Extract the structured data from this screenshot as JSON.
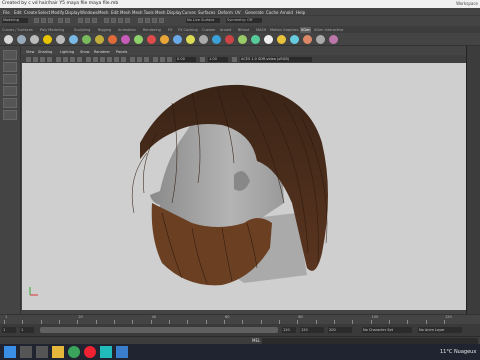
{
  "window": {
    "title": "Created by c vd hair/hair Y5 maya file maya file.mb",
    "workspace": "Workspace"
  },
  "menubar": [
    "File",
    "Edit",
    "Create",
    "Select",
    "Modify",
    "Display",
    "Windows",
    "Mesh",
    "Edit Mesh",
    "Mesh Tools",
    "Mesh Display",
    "Curves",
    "Surfaces",
    "Deform",
    "UV",
    "Generate",
    "Cache",
    "Arnold",
    "Help"
  ],
  "statusline": {
    "mode": "Modeling",
    "live_surface": "No Live Surface",
    "symmetry": "Symmetry: Off",
    "icons": [
      "new-scene",
      "open-scene",
      "save-scene",
      "undo",
      "redo",
      "select-hierarchy",
      "select-object",
      "select-component",
      "snap-grid",
      "snap-curve",
      "snap-point",
      "snap-surface",
      "render-frame",
      "ipr-render",
      "render-settings",
      "hypershade"
    ]
  },
  "shelf_tabs": [
    {
      "label": "Curves / Surfaces",
      "active": false
    },
    {
      "label": "Poly Modeling",
      "active": false
    },
    {
      "label": "Sculpting",
      "active": false
    },
    {
      "label": "Rigging",
      "active": false
    },
    {
      "label": "Animation",
      "active": false
    },
    {
      "label": "Rendering",
      "active": false
    },
    {
      "label": "FX",
      "active": false
    },
    {
      "label": "FX Caching",
      "active": false
    },
    {
      "label": "Custom",
      "active": false
    },
    {
      "label": "Arnold",
      "active": false
    },
    {
      "label": "Bifrost",
      "active": false
    },
    {
      "label": "MASH",
      "active": false
    },
    {
      "label": "Motion Graphics",
      "active": false
    },
    {
      "label": "XGen",
      "active": true
    },
    {
      "label": "XGen Interactive",
      "active": false
    }
  ],
  "shelf_icons": [
    {
      "name": "sphere",
      "color": "#d7d7d7"
    },
    {
      "name": "cube",
      "color": "#9ab"
    },
    {
      "name": "cylinder",
      "color": "#bbb"
    },
    {
      "name": "cone",
      "color": "#e8c400"
    },
    {
      "name": "plane",
      "color": "#bbb"
    },
    {
      "name": "torus",
      "color": "#7ab8e6"
    },
    {
      "name": "xgen-description",
      "color": "#7aba5c"
    },
    {
      "name": "xgen-editor",
      "color": "#c0ad3a"
    },
    {
      "name": "groom",
      "color": "#e06b3a"
    },
    {
      "name": "guide",
      "color": "#c65bb8"
    },
    {
      "name": "comb",
      "color": "#8fd16a"
    },
    {
      "name": "cut",
      "color": "#dd4b4b"
    },
    {
      "name": "noise",
      "color": "#e8a638"
    },
    {
      "name": "clump",
      "color": "#6aa9e8"
    },
    {
      "name": "coil",
      "color": "#dddd55"
    },
    {
      "name": "smooth",
      "color": "#aaa"
    },
    {
      "name": "density",
      "color": "#3aa2d8"
    },
    {
      "name": "length",
      "color": "#c44"
    },
    {
      "name": "width",
      "color": "#9c6"
    },
    {
      "name": "preview",
      "color": "#5c9"
    },
    {
      "name": "render",
      "color": "#eee"
    },
    {
      "name": "settings",
      "color": "#e7c43a"
    },
    {
      "name": "expression",
      "color": "#6cd"
    },
    {
      "name": "modifier",
      "color": "#d86"
    },
    {
      "name": "export",
      "color": "#aaa"
    },
    {
      "name": "import",
      "color": "#b7a"
    }
  ],
  "viewport": {
    "menu": [
      "View",
      "Shading",
      "Lighting",
      "Show",
      "Renderer",
      "Panels"
    ],
    "gamma": "0.00",
    "exposure": "1.00",
    "color_space": "ACES 1.0 SDR-video (sRGB)",
    "background": "#cfcfcf"
  },
  "timeline": {
    "ticks": [
      "1",
      "5",
      "10",
      "15",
      "20",
      "25",
      "30",
      "35",
      "40",
      "45",
      "50",
      "55",
      "60",
      "65",
      "70",
      "75",
      "80",
      "85",
      "90",
      "95",
      "100",
      "105",
      "110",
      "115",
      "120"
    ],
    "current_frame": "1"
  },
  "range": {
    "start": "1",
    "playback_start": "1",
    "playback_end": "120",
    "end": "120",
    "end2": "200",
    "character_set": "No Character Set",
    "anim_layer": "No Anim Layer",
    "fps": "24 fps"
  },
  "cmdline": {
    "label": "MEL"
  },
  "taskbar": {
    "apps": [
      "start",
      "search",
      "file-explorer",
      "chrome",
      "opera",
      "maya",
      "task-view"
    ],
    "weather": "11°C  Nuageux"
  }
}
